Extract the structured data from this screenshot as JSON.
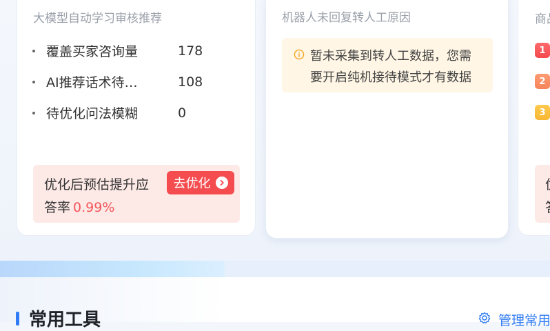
{
  "card1": {
    "title": "大模型自动学习审核推荐",
    "metrics": [
      {
        "label": "覆盖买家咨询量",
        "value": "178"
      },
      {
        "label": "AI推荐话术待…",
        "value": "108"
      },
      {
        "label": "待优化问法模糊",
        "value": "0"
      }
    ],
    "tip": {
      "line1": "优化后预估提升应",
      "line2_prefix": "答率",
      "rate": "0.99%",
      "button_label": "去优化"
    }
  },
  "card2": {
    "title": "机器人未回复转人工原因",
    "notice": {
      "line1": "暂未采集到转人工数据，您需",
      "line2": "要开启纯机接待模式才有数据"
    }
  },
  "card3": {
    "title": "商品",
    "ranks": [
      "1",
      "2",
      "3"
    ],
    "tip": {
      "line1": "优",
      "line2": "答"
    }
  },
  "section": {
    "title": "常用工具",
    "manage_label": "管理常用"
  },
  "colors": {
    "primary": "#2f7cf6",
    "danger": "#f54c4f",
    "warning_icon": "#f5a623",
    "rank1": "#f4484c",
    "rank2": "#f6855a",
    "rank3": "#f7b733"
  },
  "icons": {
    "arrow": "chevron-right-circle-icon",
    "info": "info-circle-icon",
    "gear": "gear-icon"
  }
}
